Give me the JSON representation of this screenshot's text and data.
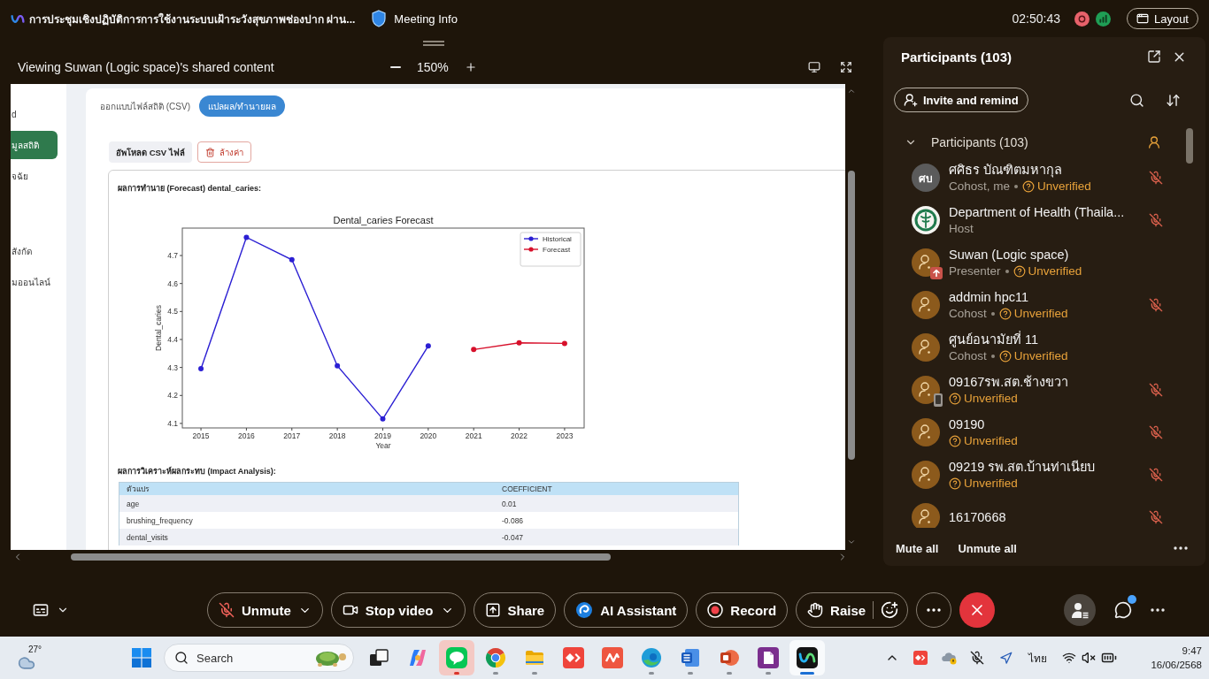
{
  "title_bar": {
    "meeting_title": "การประชุมเชิงปฏิบัติการการใช้งานระบบเฝ้าระวังสุขภาพช่องปาก ผ่าน...",
    "meeting_info": "Meeting Info",
    "timer": "02:50:43",
    "layout_button": "Layout"
  },
  "share_view": {
    "caption": "Viewing Suwan (Logic space)'s shared content",
    "zoom": "150%",
    "sidebar": [
      {
        "label": "d",
        "selected": false
      },
      {
        "label": "มูลสถิติ",
        "selected": true
      },
      {
        "label": "จฉัย",
        "selected": false
      },
      {
        "label": "สังกัด",
        "selected": false
      },
      {
        "label": "มออนไลน์",
        "selected": false
      }
    ],
    "tabs": [
      {
        "label": "ออกแบบไฟล์สถิติ (CSV)",
        "selected": false
      },
      {
        "label": "แปลผล/ทำนายผล",
        "selected": true
      }
    ],
    "actions": [
      {
        "kind": "upload",
        "label": "อัพโหลด CSV ไฟล์"
      },
      {
        "kind": "clear",
        "label": "ล้างค่า"
      }
    ],
    "forecast": {
      "heading": "ผลการทำนาย (Forecast) dental_caries:",
      "chart_data": {
        "type": "line",
        "title": "Dental_caries Forecast",
        "xlabel": "Year",
        "ylabel": "Dental_caries",
        "x": [
          2015,
          2016,
          2017,
          2018,
          2019,
          2020,
          2021,
          2022,
          2023
        ],
        "series": [
          {
            "name": "Historical",
            "color": "#2b1fd3",
            "marker": "o",
            "values": [
              4.296,
              4.765,
              4.685,
              4.306,
              4.116,
              4.377,
              null,
              null,
              null
            ]
          },
          {
            "name": "Forecast",
            "color": "#d7102b",
            "marker": "o",
            "values": [
              null,
              null,
              null,
              null,
              null,
              null,
              4.364,
              4.388,
              4.386
            ]
          }
        ],
        "xlim": [
          2014.59,
          2023.43
        ],
        "ylim": [
          4.084,
          4.798
        ],
        "xticks": [
          2015,
          2016,
          2017,
          2018,
          2019,
          2020,
          2021,
          2022,
          2023
        ],
        "yticks": [
          4.1,
          4.2,
          4.3,
          4.4,
          4.5,
          4.6,
          4.7
        ],
        "legend": "upper right"
      }
    },
    "impact": {
      "heading": "ผลการวิเคราะห์ผลกระทบ (Impact Analysis):",
      "columns": [
        "ตัวแปร",
        "COEFFICIENT"
      ],
      "rows": [
        [
          "age",
          "0.01"
        ],
        [
          "brushing_frequency",
          "-0.086"
        ],
        [
          "dental_visits",
          "-0.047"
        ]
      ]
    }
  },
  "participants_panel": {
    "title": "Participants (103)",
    "invite_button": "Invite and remind",
    "group": {
      "label": "Participants (103)",
      "expanded": true
    },
    "participants": [
      {
        "name": "ศศิธร บัณฑิตมหากุล",
        "kind": "initials",
        "initials": "ศบ",
        "role": "Cohost, me",
        "status": "Unverified",
        "presenter": false,
        "mobile": false,
        "muted": true
      },
      {
        "name": "Department of Health (Thaila...",
        "kind": "logo",
        "role": "Host",
        "presenter": false,
        "mobile": false,
        "muted": true
      },
      {
        "name": "Suwan (Logic space)",
        "kind": "guest",
        "role": "Presenter",
        "status": "Unverified",
        "presenter": true,
        "mobile": false,
        "muted": false
      },
      {
        "name": "addmin hpc11",
        "kind": "guest",
        "role": "Cohost",
        "status": "Unverified",
        "presenter": false,
        "mobile": false,
        "muted": true
      },
      {
        "name": "ศูนย์อนามัยที่ 11",
        "kind": "guest",
        "role": "Cohost",
        "status": "Unverified",
        "presenter": false,
        "mobile": false,
        "muted": false
      },
      {
        "name": "09167รพ.สต.ช้างขวา",
        "kind": "guest",
        "status": "Unverified",
        "presenter": false,
        "mobile": true,
        "muted": true
      },
      {
        "name": "09190",
        "kind": "guest",
        "status": "Unverified",
        "presenter": false,
        "mobile": false,
        "muted": true
      },
      {
        "name": "09219 รพ.สต.บ้านท่าเนียบ",
        "kind": "guest",
        "status": "Unverified",
        "presenter": false,
        "mobile": false,
        "muted": true
      },
      {
        "name": "16170668",
        "kind": "guest",
        "presenter": false,
        "mobile": false,
        "muted": true
      }
    ],
    "footer": [
      "Mute all",
      "Unmute all"
    ]
  },
  "controls": {
    "buttons": [
      {
        "kind": "mic",
        "label": "Unmute",
        "menu": true
      },
      {
        "kind": "video",
        "label": "Stop video",
        "menu": true
      },
      {
        "kind": "share",
        "label": "Share",
        "menu": false
      },
      {
        "kind": "ai",
        "label": "AI Assistant",
        "menu": false
      },
      {
        "kind": "record",
        "label": "Record",
        "menu": false
      },
      {
        "kind": "raise",
        "label": "Raise",
        "menu": false
      }
    ],
    "side": [
      {
        "kind": "participants",
        "selected": true,
        "unread": false
      },
      {
        "kind": "chat",
        "selected": false,
        "unread": true
      }
    ]
  },
  "taskbar": {
    "weather": "27°",
    "search": {
      "placeholder": "Search"
    },
    "apps": [
      {
        "kind": "task-view",
        "open": false,
        "selected": false,
        "attention": false
      },
      {
        "kind": "spark",
        "open": false,
        "selected": false,
        "attention": false
      },
      {
        "kind": "chat",
        "open": true,
        "selected": false,
        "attention": true
      },
      {
        "kind": "browser",
        "open": true,
        "selected": false,
        "attention": false
      },
      {
        "kind": "folder",
        "open": true,
        "selected": false,
        "attention": false
      },
      {
        "kind": "diamond",
        "open": false,
        "selected": false,
        "attention": false
      },
      {
        "kind": "zigzag",
        "open": false,
        "selected": false,
        "attention": false
      },
      {
        "kind": "swirl",
        "open": true,
        "selected": false,
        "attention": false
      },
      {
        "kind": "document",
        "open": true,
        "selected": false,
        "attention": false
      },
      {
        "kind": "slides",
        "open": true,
        "selected": false,
        "attention": false
      },
      {
        "kind": "pdf",
        "open": true,
        "selected": false,
        "attention": false
      },
      {
        "kind": "meeting",
        "open": true,
        "selected": true,
        "attention": false
      }
    ],
    "language": "ไทย",
    "time": "9:47",
    "date": "16/06/2568"
  }
}
